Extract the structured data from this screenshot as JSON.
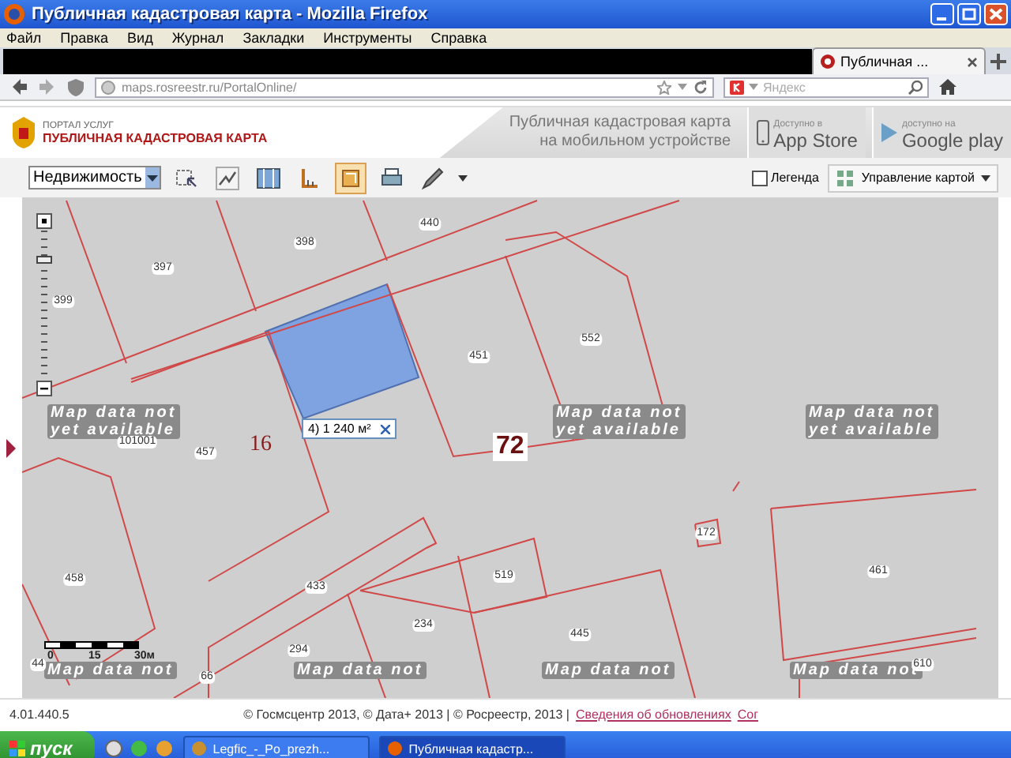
{
  "window": {
    "title": "Публичная кадастровая карта - Mozilla Firefox"
  },
  "menu": [
    "Файл",
    "Правка",
    "Вид",
    "Журнал",
    "Закладки",
    "Инструменты",
    "Справка"
  ],
  "tabs": [
    {
      "label": "Публичная ...",
      "selected": true
    }
  ],
  "address_bar": {
    "url": "maps.rosreestr.ru/PortalOnline/"
  },
  "search": {
    "placeholder": "Яндекс"
  },
  "site_header": {
    "portal": "ПОРТАЛ УСЛУГ",
    "title": "ПУБЛИЧНАЯ КАДАСТРОВАЯ КАРТА",
    "mobile_promo": "Публичная кадастровая карта\nна мобильном устройстве",
    "stores": [
      {
        "kind": "apple",
        "caption": "Доступно в",
        "name": "App Store"
      },
      {
        "kind": "google",
        "caption": "доступно на",
        "name": "Google play"
      }
    ]
  },
  "toolbar": {
    "layer_select": "Недвижимость",
    "tools": [
      {
        "kind": "identify",
        "selected": false
      },
      {
        "kind": "route",
        "selected": false
      },
      {
        "kind": "layers",
        "selected": false
      },
      {
        "kind": "distance",
        "selected": false
      },
      {
        "kind": "area",
        "selected": true
      },
      {
        "kind": "print",
        "selected": false
      },
      {
        "kind": "draw",
        "selected": false
      }
    ],
    "legend": {
      "label": "Легенда",
      "checked": false
    },
    "map_control": "Управление картой"
  },
  "map": {
    "zoom": {
      "level": 0.81
    },
    "parcel_labels": [
      "397",
      "398",
      "440",
      "399",
      "451",
      "552",
      "101001",
      "457",
      "458",
      "433",
      "519",
      "172",
      "461",
      "234",
      "445",
      "294",
      "66",
      "44",
      "610"
    ],
    "block_labels": [
      "16",
      "72"
    ],
    "tooltip": "4) 1 240 м²",
    "no_data_notes": [
      "Map data not\nyet available",
      "Map data not\nyet available",
      "Map data not\nyet available",
      "Map data not",
      "Map data not",
      "Map data not",
      "Map data not"
    ],
    "scale_labels": [
      "0",
      "15",
      "30м"
    ]
  },
  "footer": {
    "version": "4.01.440.5",
    "copyright": "© Госмсцентр 2013, © Дата+ 2013 | © Росреестр, 2013 |",
    "links": [
      "Сведения об обновлениях",
      "Сог"
    ]
  },
  "taskbar": {
    "start": "пуск",
    "tasks": [
      {
        "label": "Legfic_-_Po_prezh...",
        "selected": false
      },
      {
        "label": "Публичная кадастр...",
        "selected": true
      }
    ]
  }
}
